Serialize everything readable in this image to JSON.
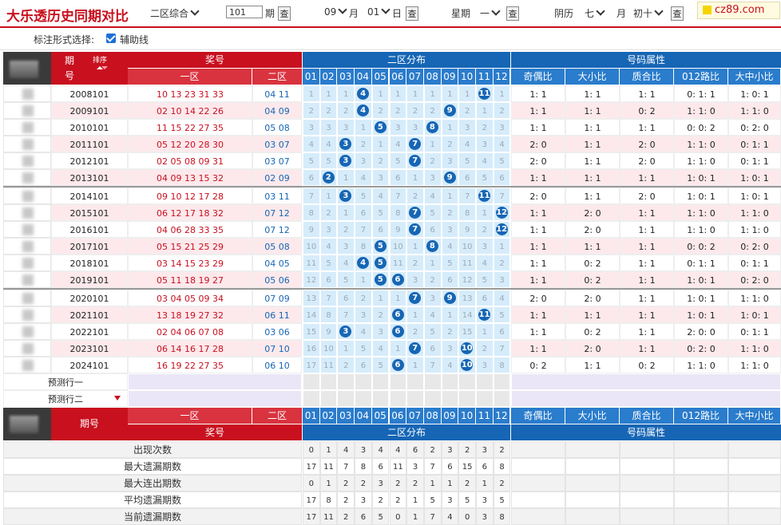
{
  "header": {
    "title": "大乐透历史同期对比",
    "zone_select": "二区综合",
    "period_input": "101",
    "period_label": "期",
    "query_label": "查",
    "month_value": "09",
    "month_label": "月",
    "day_value": "01",
    "day_label": "日",
    "week_label": "星期",
    "week_value": "一",
    "lunar_label": "阴历",
    "lunar_month": "七",
    "lunar_day": "初十",
    "logo_text": "cz89.com"
  },
  "options": {
    "label": "标注形式选择:",
    "checkbox_label": "辅助线",
    "checked": true
  },
  "table_header": {
    "period": "期",
    "period2": "号",
    "sort": "排序",
    "prize": "奖号",
    "zone1": "一区",
    "zone2": "二区",
    "dist": "二区分布",
    "attr": "号码属性",
    "numbers": [
      "01",
      "02",
      "03",
      "04",
      "05",
      "06",
      "07",
      "08",
      "09",
      "10",
      "11",
      "12"
    ],
    "attrs": [
      "奇偶比",
      "大小比",
      "质合比",
      "012路比",
      "大中小比"
    ]
  },
  "rows": [
    {
      "period": "2008101",
      "zone1": "10 13 23 31 33",
      "zone2": "04 11",
      "dist": [
        "1",
        "1",
        "1",
        "4",
        "1",
        "1",
        "1",
        "1",
        "1",
        "1",
        "11",
        "1"
      ],
      "balls": [
        4,
        11
      ],
      "attrs": [
        "1: 1",
        "1: 1",
        "1: 1",
        "0: 1: 1",
        "1: 0: 1"
      ]
    },
    {
      "period": "2009101",
      "zone1": "02 10 14 22 26",
      "zone2": "04 09",
      "dist": [
        "2",
        "2",
        "2",
        "4",
        "2",
        "2",
        "2",
        "2",
        "9",
        "2",
        "1",
        "2"
      ],
      "balls": [
        4,
        9
      ],
      "attrs": [
        "1: 1",
        "1: 1",
        "0: 2",
        "1: 1: 0",
        "1: 1: 0"
      ]
    },
    {
      "period": "2010101",
      "zone1": "11 15 22 27 35",
      "zone2": "05 08",
      "dist": [
        "3",
        "3",
        "3",
        "1",
        "5",
        "3",
        "3",
        "8",
        "1",
        "3",
        "2",
        "3"
      ],
      "balls": [
        5,
        8
      ],
      "attrs": [
        "1: 1",
        "1: 1",
        "1: 1",
        "0: 0: 2",
        "0: 2: 0"
      ]
    },
    {
      "period": "2011101",
      "zone1": "05 12 20 28 30",
      "zone2": "03 07",
      "dist": [
        "4",
        "4",
        "3",
        "2",
        "1",
        "4",
        "7",
        "1",
        "2",
        "4",
        "3",
        "4"
      ],
      "balls": [
        3,
        7
      ],
      "attrs": [
        "2: 0",
        "1: 1",
        "2: 0",
        "1: 1: 0",
        "0: 1: 1"
      ]
    },
    {
      "period": "2012101",
      "zone1": "02 05 08 09 31",
      "zone2": "03 07",
      "dist": [
        "5",
        "5",
        "3",
        "3",
        "2",
        "5",
        "7",
        "2",
        "3",
        "5",
        "4",
        "5"
      ],
      "balls": [
        3,
        7
      ],
      "attrs": [
        "2: 0",
        "1: 1",
        "2: 0",
        "1: 1: 0",
        "0: 1: 1"
      ]
    },
    {
      "period": "2013101",
      "zone1": "04 09 13 15 32",
      "zone2": "02 09",
      "dist": [
        "6",
        "2",
        "1",
        "4",
        "3",
        "6",
        "1",
        "3",
        "9",
        "6",
        "5",
        "6"
      ],
      "balls": [
        2,
        9
      ],
      "attrs": [
        "1: 1",
        "1: 1",
        "1: 1",
        "1: 0: 1",
        "1: 0: 1"
      ]
    },
    {
      "period": "2014101",
      "zone1": "09 10 12 17 28",
      "zone2": "03 11",
      "dist": [
        "7",
        "1",
        "3",
        "5",
        "4",
        "7",
        "2",
        "4",
        "1",
        "7",
        "11",
        "7"
      ],
      "balls": [
        3,
        11
      ],
      "attrs": [
        "2: 0",
        "1: 1",
        "2: 0",
        "1: 0: 1",
        "1: 0: 1"
      ]
    },
    {
      "period": "2015101",
      "zone1": "06 12 17 18 32",
      "zone2": "07 12",
      "dist": [
        "8",
        "2",
        "1",
        "6",
        "5",
        "8",
        "7",
        "5",
        "2",
        "8",
        "1",
        "12"
      ],
      "balls": [
        7,
        12
      ],
      "attrs": [
        "1: 1",
        "2: 0",
        "1: 1",
        "1: 1: 0",
        "1: 1: 0"
      ]
    },
    {
      "period": "2016101",
      "zone1": "04 06 28 33 35",
      "zone2": "07 12",
      "dist": [
        "9",
        "3",
        "2",
        "7",
        "6",
        "9",
        "7",
        "6",
        "3",
        "9",
        "2",
        "12"
      ],
      "balls": [
        7,
        12
      ],
      "attrs": [
        "1: 1",
        "2: 0",
        "1: 1",
        "1: 1: 0",
        "1: 1: 0"
      ]
    },
    {
      "period": "2017101",
      "zone1": "05 15 21 25 29",
      "zone2": "05 08",
      "dist": [
        "10",
        "4",
        "3",
        "8",
        "5",
        "10",
        "1",
        "8",
        "4",
        "10",
        "3",
        "1"
      ],
      "balls": [
        5,
        8
      ],
      "attrs": [
        "1: 1",
        "1: 1",
        "1: 1",
        "0: 0: 2",
        "0: 2: 0"
      ]
    },
    {
      "period": "2018101",
      "zone1": "03 14 15 23 29",
      "zone2": "04 05",
      "dist": [
        "11",
        "5",
        "4",
        "4",
        "5",
        "11",
        "2",
        "1",
        "5",
        "11",
        "4",
        "2"
      ],
      "balls": [
        4,
        5
      ],
      "attrs": [
        "1: 1",
        "0: 2",
        "1: 1",
        "0: 1: 1",
        "0: 1: 1"
      ]
    },
    {
      "period": "2019101",
      "zone1": "05 11 18 19 27",
      "zone2": "05 06",
      "dist": [
        "12",
        "6",
        "5",
        "1",
        "5",
        "6",
        "3",
        "2",
        "6",
        "12",
        "5",
        "3"
      ],
      "balls": [
        5,
        6
      ],
      "attrs": [
        "1: 1",
        "0: 2",
        "1: 1",
        "1: 0: 1",
        "0: 2: 0"
      ]
    },
    {
      "period": "2020101",
      "zone1": "03 04 05 09 34",
      "zone2": "07 09",
      "dist": [
        "13",
        "7",
        "6",
        "2",
        "1",
        "1",
        "7",
        "3",
        "9",
        "13",
        "6",
        "4"
      ],
      "balls": [
        7,
        9
      ],
      "attrs": [
        "2: 0",
        "2: 0",
        "1: 1",
        "1: 0: 1",
        "1: 1: 0"
      ]
    },
    {
      "period": "2021101",
      "zone1": "13 18 19 27 32",
      "zone2": "06 11",
      "dist": [
        "14",
        "8",
        "7",
        "3",
        "2",
        "6",
        "1",
        "4",
        "1",
        "14",
        "11",
        "5"
      ],
      "balls": [
        6,
        11
      ],
      "attrs": [
        "1: 1",
        "1: 1",
        "1: 1",
        "1: 0: 1",
        "1: 0: 1"
      ]
    },
    {
      "period": "2022101",
      "zone1": "02 04 06 07 08",
      "zone2": "03 06",
      "dist": [
        "15",
        "9",
        "3",
        "4",
        "3",
        "6",
        "2",
        "5",
        "2",
        "15",
        "1",
        "6"
      ],
      "balls": [
        3,
        6
      ],
      "attrs": [
        "1: 1",
        "0: 2",
        "1: 1",
        "2: 0: 0",
        "0: 1: 1"
      ]
    },
    {
      "period": "2023101",
      "zone1": "06 14 16 17 28",
      "zone2": "07 10",
      "dist": [
        "16",
        "10",
        "1",
        "5",
        "4",
        "1",
        "7",
        "6",
        "3",
        "10",
        "2",
        "7"
      ],
      "balls": [
        7,
        10
      ],
      "attrs": [
        "1: 1",
        "2: 0",
        "1: 1",
        "0: 2: 0",
        "1: 1: 0"
      ]
    },
    {
      "period": "2024101",
      "zone1": "16 19 22 27 35",
      "zone2": "06 10",
      "dist": [
        "17",
        "11",
        "2",
        "6",
        "5",
        "6",
        "1",
        "7",
        "4",
        "10",
        "3",
        "8"
      ],
      "balls": [
        6,
        10
      ],
      "attrs": [
        "0: 2",
        "1: 1",
        "0: 2",
        "1: 1: 0",
        "1: 1: 0"
      ]
    }
  ],
  "predict": [
    "预测行一",
    "预测行二"
  ],
  "footer_header": {
    "period": "期号",
    "zone1": "一区",
    "zone2": "二区",
    "prize": "奖号",
    "dist": "二区分布",
    "attr": "号码属性"
  },
  "stats": [
    {
      "label": "出现次数",
      "values": [
        "0",
        "1",
        "4",
        "3",
        "4",
        "4",
        "6",
        "2",
        "3",
        "2",
        "3",
        "2"
      ]
    },
    {
      "label": "最大遗漏期数",
      "values": [
        "17",
        "11",
        "7",
        "8",
        "6",
        "11",
        "3",
        "7",
        "6",
        "15",
        "6",
        "8"
      ]
    },
    {
      "label": "最大连出期数",
      "values": [
        "0",
        "1",
        "2",
        "2",
        "3",
        "2",
        "2",
        "1",
        "1",
        "2",
        "1",
        "2"
      ]
    },
    {
      "label": "平均遗漏期数",
      "values": [
        "17",
        "8",
        "2",
        "3",
        "2",
        "2",
        "1",
        "5",
        "3",
        "5",
        "3",
        "5"
      ]
    },
    {
      "label": "当前遗漏期数",
      "values": [
        "17",
        "11",
        "2",
        "6",
        "5",
        "0",
        "1",
        "7",
        "4",
        "0",
        "3",
        "8"
      ]
    }
  ],
  "colors": {
    "red": "#c8101e",
    "blue": "#1666b5",
    "pink": "#fde9ec",
    "lightblue": "#d6ecfa"
  }
}
